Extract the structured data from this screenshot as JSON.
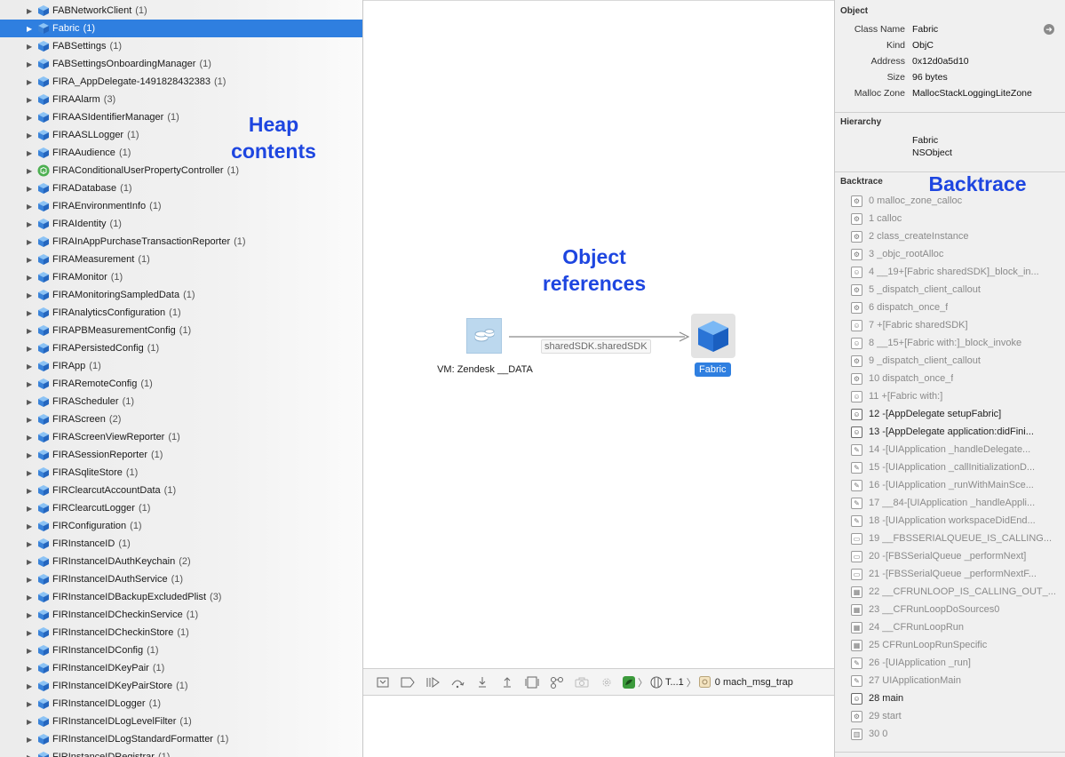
{
  "heap": {
    "items": [
      {
        "name": "FABNetworkClient",
        "count": "(1)",
        "icon": "cube-icon"
      },
      {
        "name": "Fabric",
        "count": "(1)",
        "icon": "cube-icon",
        "selected": true
      },
      {
        "name": "FABSettings",
        "count": "(1)",
        "icon": "cube-icon"
      },
      {
        "name": "FABSettingsOnboardingManager",
        "count": "(1)",
        "icon": "cube-icon"
      },
      {
        "name": "FIRA_AppDelegate-1491828432383",
        "count": "(1)",
        "icon": "cube-icon"
      },
      {
        "name": "FIRAAlarm",
        "count": "(3)",
        "icon": "cube-icon"
      },
      {
        "name": "FIRAASIdentifierManager",
        "count": "(1)",
        "icon": "cube-icon"
      },
      {
        "name": "FIRAASLLogger",
        "count": "(1)",
        "icon": "cube-icon"
      },
      {
        "name": "FIRAAudience",
        "count": "(1)",
        "icon": "cube-icon"
      },
      {
        "name": "FIRAConditionalUserPropertyController",
        "count": "(1)",
        "icon": "green-gear-icon"
      },
      {
        "name": "FIRADatabase",
        "count": "(1)",
        "icon": "cube-icon"
      },
      {
        "name": "FIRAEnvironmentInfo",
        "count": "(1)",
        "icon": "cube-icon"
      },
      {
        "name": "FIRAIdentity",
        "count": "(1)",
        "icon": "cube-icon"
      },
      {
        "name": "FIRAInAppPurchaseTransactionReporter",
        "count": "(1)",
        "icon": "cube-icon"
      },
      {
        "name": "FIRAMeasurement",
        "count": "(1)",
        "icon": "cube-icon"
      },
      {
        "name": "FIRAMonitor",
        "count": "(1)",
        "icon": "cube-icon"
      },
      {
        "name": "FIRAMonitoringSampledData",
        "count": "(1)",
        "icon": "cube-icon"
      },
      {
        "name": "FIRAnalyticsConfiguration",
        "count": "(1)",
        "icon": "cube-icon"
      },
      {
        "name": "FIRAPBMeasurementConfig",
        "count": "(1)",
        "icon": "cube-icon"
      },
      {
        "name": "FIRAPersistedConfig",
        "count": "(1)",
        "icon": "cube-icon"
      },
      {
        "name": "FIRApp",
        "count": "(1)",
        "icon": "cube-icon"
      },
      {
        "name": "FIRARemoteConfig",
        "count": "(1)",
        "icon": "cube-icon"
      },
      {
        "name": "FIRAScheduler",
        "count": "(1)",
        "icon": "cube-icon"
      },
      {
        "name": "FIRAScreen",
        "count": "(2)",
        "icon": "cube-icon"
      },
      {
        "name": "FIRAScreenViewReporter",
        "count": "(1)",
        "icon": "cube-icon"
      },
      {
        "name": "FIRASessionReporter",
        "count": "(1)",
        "icon": "cube-icon"
      },
      {
        "name": "FIRASqliteStore",
        "count": "(1)",
        "icon": "cube-icon"
      },
      {
        "name": "FIRClearcutAccountData",
        "count": "(1)",
        "icon": "cube-icon"
      },
      {
        "name": "FIRClearcutLogger",
        "count": "(1)",
        "icon": "cube-icon"
      },
      {
        "name": "FIRConfiguration",
        "count": "(1)",
        "icon": "cube-icon"
      },
      {
        "name": "FIRInstanceID",
        "count": "(1)",
        "icon": "cube-icon"
      },
      {
        "name": "FIRInstanceIDAuthKeychain",
        "count": "(2)",
        "icon": "cube-icon"
      },
      {
        "name": "FIRInstanceIDAuthService",
        "count": "(1)",
        "icon": "cube-icon"
      },
      {
        "name": "FIRInstanceIDBackupExcludedPlist",
        "count": "(3)",
        "icon": "cube-icon"
      },
      {
        "name": "FIRInstanceIDCheckinService",
        "count": "(1)",
        "icon": "cube-icon"
      },
      {
        "name": "FIRInstanceIDCheckinStore",
        "count": "(1)",
        "icon": "cube-icon"
      },
      {
        "name": "FIRInstanceIDConfig",
        "count": "(1)",
        "icon": "cube-icon"
      },
      {
        "name": "FIRInstanceIDKeyPair",
        "count": "(1)",
        "icon": "cube-icon"
      },
      {
        "name": "FIRInstanceIDKeyPairStore",
        "count": "(1)",
        "icon": "cube-icon"
      },
      {
        "name": "FIRInstanceIDLogger",
        "count": "(1)",
        "icon": "cube-icon"
      },
      {
        "name": "FIRInstanceIDLogLevelFilter",
        "count": "(1)",
        "icon": "cube-icon"
      },
      {
        "name": "FIRInstanceIDLogStandardFormatter",
        "count": "(1)",
        "icon": "cube-icon"
      },
      {
        "name": "FIRInstanceIDRegistrar",
        "count": "(1)",
        "icon": "cube-icon"
      }
    ]
  },
  "annotations": {
    "heap_line1": "Heap",
    "heap_line2": "contents",
    "refs_line1": "Object",
    "refs_line2": "references",
    "backtrace": "Backtrace"
  },
  "graph": {
    "source_label": "VM: Zendesk __DATA",
    "edge_label": "sharedSDK.sharedSDK",
    "target_label": "Fabric"
  },
  "toolbar": {
    "thread_label": "T...1",
    "frame_label": "0 mach_msg_trap"
  },
  "inspector": {
    "object_title": "Object",
    "fields": [
      {
        "key": "Class Name",
        "value": "Fabric"
      },
      {
        "key": "Kind",
        "value": "ObjC"
      },
      {
        "key": "Address",
        "value": "0x12d0a5d10"
      },
      {
        "key": "Size",
        "value": "96 bytes"
      },
      {
        "key": "Malloc Zone",
        "value": "MallocStackLoggingLiteZone"
      }
    ],
    "hierarchy_title": "Hierarchy",
    "hierarchy": [
      "Fabric",
      "NSObject"
    ],
    "backtrace_title": "Backtrace",
    "backtrace": [
      {
        "text": "0 malloc_zone_calloc",
        "dark": false,
        "icon": "gear-icon"
      },
      {
        "text": "1 calloc",
        "dark": false,
        "icon": "gear-icon"
      },
      {
        "text": "2 class_createInstance",
        "dark": false,
        "icon": "gear-icon"
      },
      {
        "text": "3 _objc_rootAlloc",
        "dark": false,
        "icon": "gear-icon"
      },
      {
        "text": "4 __19+[Fabric sharedSDK]_block_in...",
        "dark": false,
        "icon": "person-icon"
      },
      {
        "text": "5 _dispatch_client_callout",
        "dark": false,
        "icon": "gear-icon"
      },
      {
        "text": "6 dispatch_once_f",
        "dark": false,
        "icon": "gear-icon"
      },
      {
        "text": "7 +[Fabric sharedSDK]",
        "dark": false,
        "icon": "person-icon"
      },
      {
        "text": "8 __15+[Fabric with:]_block_invoke",
        "dark": false,
        "icon": "person-icon"
      },
      {
        "text": "9 _dispatch_client_callout",
        "dark": false,
        "icon": "gear-icon"
      },
      {
        "text": "10 dispatch_once_f",
        "dark": false,
        "icon": "gear-icon"
      },
      {
        "text": "11 +[Fabric with:]",
        "dark": false,
        "icon": "person-icon"
      },
      {
        "text": "12 -[AppDelegate setupFabric]",
        "dark": true,
        "icon": "person-icon"
      },
      {
        "text": "13 -[AppDelegate application:didFini...",
        "dark": true,
        "icon": "person-icon"
      },
      {
        "text": "14 -[UIApplication _handleDelegate...",
        "dark": false,
        "icon": "pen-icon"
      },
      {
        "text": "15 -[UIApplication _callInitializationD...",
        "dark": false,
        "icon": "pen-icon"
      },
      {
        "text": "16 -[UIApplication _runWithMainSce...",
        "dark": false,
        "icon": "pen-icon"
      },
      {
        "text": "17 __84-[UIApplication _handleAppli...",
        "dark": false,
        "icon": "pen-icon"
      },
      {
        "text": "18 -[UIApplication workspaceDidEnd...",
        "dark": false,
        "icon": "pen-icon"
      },
      {
        "text": "19 __FBSSERIALQUEUE_IS_CALLING...",
        "dark": false,
        "icon": "window-icon"
      },
      {
        "text": "20 -[FBSSerialQueue _performNext]",
        "dark": false,
        "icon": "window-icon"
      },
      {
        "text": "21 -[FBSSerialQueue _performNextF...",
        "dark": false,
        "icon": "window-icon"
      },
      {
        "text": "22 __CFRUNLOOP_IS_CALLING_OUT_...",
        "dark": false,
        "icon": "grid-icon"
      },
      {
        "text": "23 __CFRunLoopDoSources0",
        "dark": false,
        "icon": "grid-icon"
      },
      {
        "text": "24 __CFRunLoopRun",
        "dark": false,
        "icon": "grid-icon"
      },
      {
        "text": "25 CFRunLoopRunSpecific",
        "dark": false,
        "icon": "grid-icon"
      },
      {
        "text": "26 -[UIApplication _run]",
        "dark": false,
        "icon": "pen-icon"
      },
      {
        "text": "27 UIApplicationMain",
        "dark": false,
        "icon": "pen-icon"
      },
      {
        "text": "28 main",
        "dark": true,
        "icon": "person-icon"
      },
      {
        "text": "29 start",
        "dark": false,
        "icon": "gear-icon"
      },
      {
        "text": "30 0",
        "dark": false,
        "icon": "columns-icon"
      }
    ]
  }
}
